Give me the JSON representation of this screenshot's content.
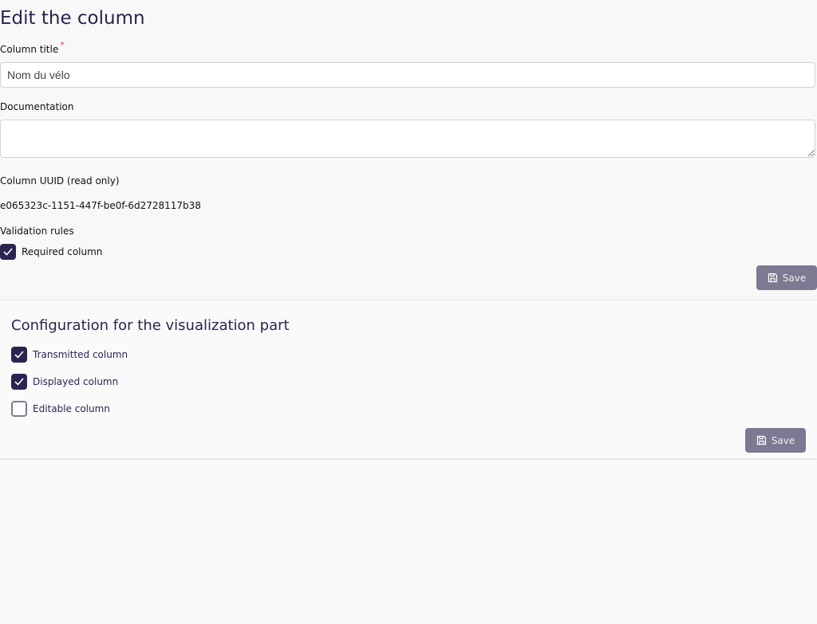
{
  "title": "Edit the column",
  "fields": {
    "column_title_label": "Column title",
    "required_mark": "*",
    "column_title_value": "Nom du vélo",
    "documentation_label": "Documentation",
    "documentation_value": "",
    "uuid_label": "Column UUID (read only)",
    "uuid_value": "e065323c-1151-447f-be0f-6d2728117b38",
    "validation_label": "Validation rules",
    "required_column": {
      "label": "Required column",
      "checked": true
    }
  },
  "save_label": "Save",
  "viz": {
    "title": "Configuration for the visualization part",
    "options": [
      {
        "label": "Transmitted column",
        "checked": true
      },
      {
        "label": "Displayed column",
        "checked": true
      },
      {
        "label": "Editable column",
        "checked": false
      }
    ],
    "save_label": "Save"
  }
}
